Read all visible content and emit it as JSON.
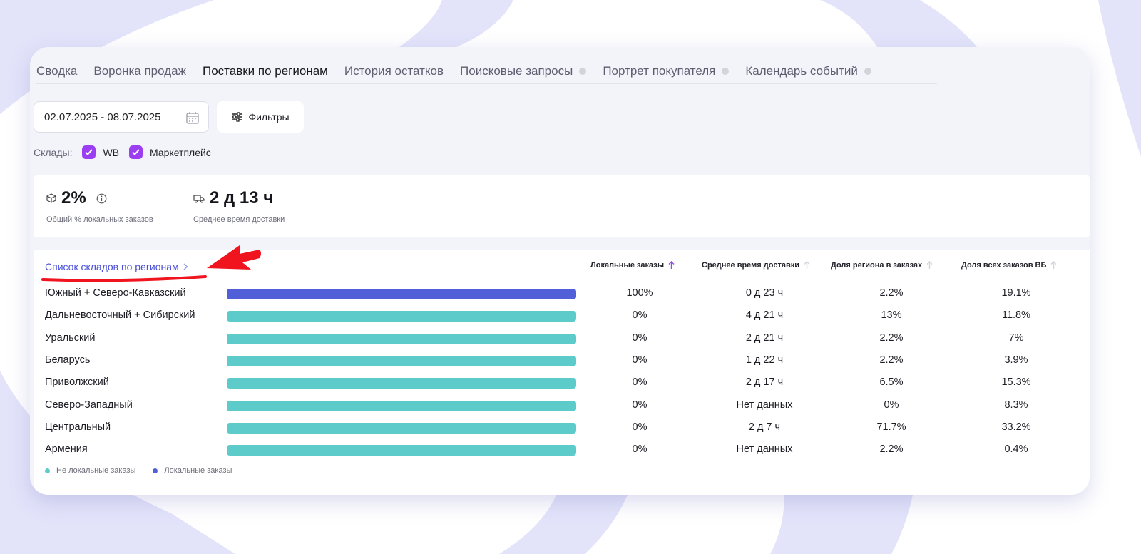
{
  "tabs": [
    {
      "label": "Сводка",
      "active": false,
      "badge": false
    },
    {
      "label": "Воронка продаж",
      "active": false,
      "badge": false
    },
    {
      "label": "Поставки по регионам",
      "active": true,
      "badge": false
    },
    {
      "label": "История остатков",
      "active": false,
      "badge": false
    },
    {
      "label": "Поисковые запросы",
      "active": false,
      "badge": true
    },
    {
      "label": "Портрет покупателя",
      "active": false,
      "badge": true
    },
    {
      "label": "Календарь событий",
      "active": false,
      "badge": true
    }
  ],
  "date_range": "02.07.2025 - 08.07.2025",
  "filters_label": "Фильтры",
  "warehouses": {
    "label": "Склады:",
    "options": [
      {
        "label": "WB",
        "checked": true
      },
      {
        "label": "Маркетплейс",
        "checked": true
      }
    ]
  },
  "stats": {
    "local_orders": {
      "value": "2%",
      "label": "Общий % локальных заказов"
    },
    "delivery_time": {
      "value": "2 д 13 ч",
      "label": "Среднее время доставки"
    }
  },
  "regions": {
    "title": "Список складов по регионам",
    "columns": [
      "Локальные заказы",
      "Среднее время доставки",
      "Доля региона в заказах",
      "Доля всех заказов ВБ"
    ],
    "rows": [
      {
        "name": "Южный + Северо-Кавказский",
        "local_share": 1.0,
        "local": "100%",
        "delivery": "0 д 23 ч",
        "region_share": "2.2%",
        "wb_share": "19.1%"
      },
      {
        "name": "Дальневосточный + Сибирский",
        "local_share": 0.0,
        "local": "0%",
        "delivery": "4 д 21 ч",
        "region_share": "13%",
        "wb_share": "11.8%"
      },
      {
        "name": "Уральский",
        "local_share": 0.0,
        "local": "0%",
        "delivery": "2 д 21 ч",
        "region_share": "2.2%",
        "wb_share": "7%"
      },
      {
        "name": "Беларусь",
        "local_share": 0.0,
        "local": "0%",
        "delivery": "1 д 22 ч",
        "region_share": "2.2%",
        "wb_share": "3.9%"
      },
      {
        "name": "Приволжский",
        "local_share": 0.0,
        "local": "0%",
        "delivery": "2 д 17 ч",
        "region_share": "6.5%",
        "wb_share": "15.3%"
      },
      {
        "name": "Северо-Западный",
        "local_share": 0.0,
        "local": "0%",
        "delivery": "Нет данных",
        "region_share": "0%",
        "wb_share": "8.3%"
      },
      {
        "name": "Центральный",
        "local_share": 0.0,
        "local": "0%",
        "delivery": "2 д 7 ч",
        "region_share": "71.7%",
        "wb_share": "33.2%"
      },
      {
        "name": "Армения",
        "local_share": 0.0,
        "local": "0%",
        "delivery": "Нет данных",
        "region_share": "2.2%",
        "wb_share": "0.4%"
      }
    ],
    "legend": [
      {
        "label": "Не локальные заказы",
        "color": "#5ecbcb"
      },
      {
        "label": "Локальные заказы",
        "color": "#5160d8"
      }
    ]
  },
  "colors": {
    "local": "#5160d8",
    "non_local": "#5ecbcb",
    "accent": "#9b3ef2",
    "annotation": "#f0141e"
  }
}
